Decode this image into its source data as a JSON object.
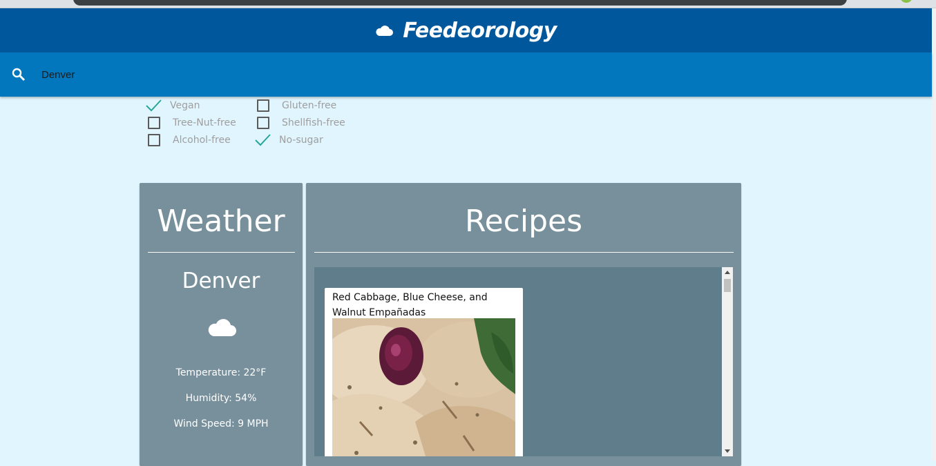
{
  "app": {
    "title": "Feedeorology"
  },
  "search": {
    "value": "Denver"
  },
  "filters": [
    {
      "label": "Vegan",
      "checked": true
    },
    {
      "label": "Tree-Nut-free",
      "checked": false
    },
    {
      "label": "Alcohol-free",
      "checked": false
    },
    {
      "label": "Gluten-free",
      "checked": false
    },
    {
      "label": "Shellfish-free",
      "checked": false
    },
    {
      "label": "No-sugar",
      "checked": true
    }
  ],
  "weather": {
    "heading": "Weather",
    "city": "Denver",
    "icon": "cloud-icon",
    "temperature": "Temperature: 22°F",
    "humidity": "Humidity: 54%",
    "wind": "Wind Speed: 9 MPH"
  },
  "recipes": {
    "heading": "Recipes",
    "items": [
      {
        "title": "Red Cabbage, Blue Cheese, and Walnut Empañadas",
        "image": "empanadas-photo"
      }
    ]
  },
  "colors": {
    "header": "#01579b",
    "searchbar": "#0277bd",
    "page": "#e1f5fe",
    "panel": "#78909c",
    "recipe_area": "#607d8b",
    "check": "#26a69a"
  }
}
